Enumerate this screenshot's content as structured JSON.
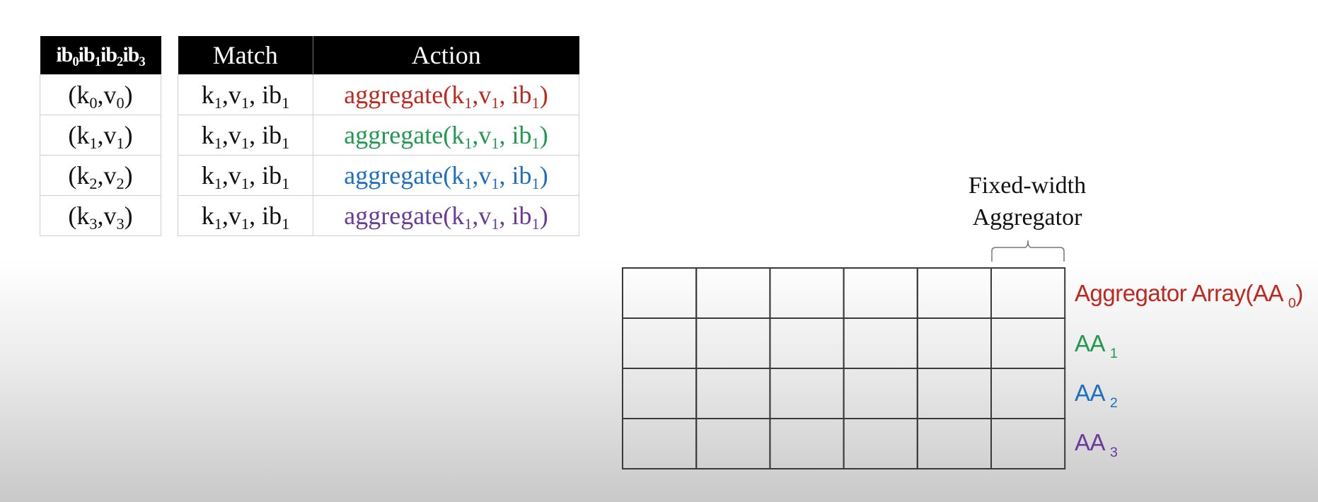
{
  "ib_table": {
    "header": [
      {
        "base": "ib",
        "sub": "0"
      },
      {
        "base": "ib",
        "sub": "1"
      },
      {
        "base": "ib",
        "sub": "2"
      },
      {
        "base": "ib",
        "sub": "3"
      }
    ],
    "rows": [
      {
        "open": "(k",
        "s1": "0",
        "mid": ",v",
        "s2": "0",
        "close": ")"
      },
      {
        "open": "(k",
        "s1": "1",
        "mid": ",v",
        "s2": "1",
        "close": ")"
      },
      {
        "open": "(k",
        "s1": "2",
        "mid": ",v",
        "s2": "2",
        "close": ")"
      },
      {
        "open": "(k",
        "s1": "3",
        "mid": ",v",
        "s2": "3",
        "close": ")"
      }
    ]
  },
  "match_action_table": {
    "headers": {
      "match": "Match",
      "action": "Action"
    },
    "match_cell": {
      "k": "k",
      "ks": "1",
      "v": ",v",
      "vs": "1",
      "ib": ", ib",
      "ibs": "1"
    },
    "action_cell": {
      "open": "aggregate(k",
      "ks": "1",
      "v": ",v",
      "vs": "1",
      "ib": ", ib",
      "ibs": "1",
      "close": ")"
    },
    "action_colors": [
      "#c0271f",
      "#1f9a4e",
      "#1e6fc0",
      "#6a3a9c"
    ]
  },
  "aggregator": {
    "brace_label_line1": "Fixed-width",
    "brace_label_line2": "Aggregator",
    "grid_rows": 4,
    "grid_cols": 6,
    "arrays": [
      {
        "text": "Aggregator Array(AA ",
        "sub": "0",
        "close": ")",
        "color": "#c0271f"
      },
      {
        "text": "AA ",
        "sub": "1",
        "close": "",
        "color": "#1f9a4e"
      },
      {
        "text": "AA ",
        "sub": "2",
        "close": "",
        "color": "#1e6fc0"
      },
      {
        "text": "AA ",
        "sub": "3",
        "close": "",
        "color": "#6a3a9c"
      }
    ]
  }
}
